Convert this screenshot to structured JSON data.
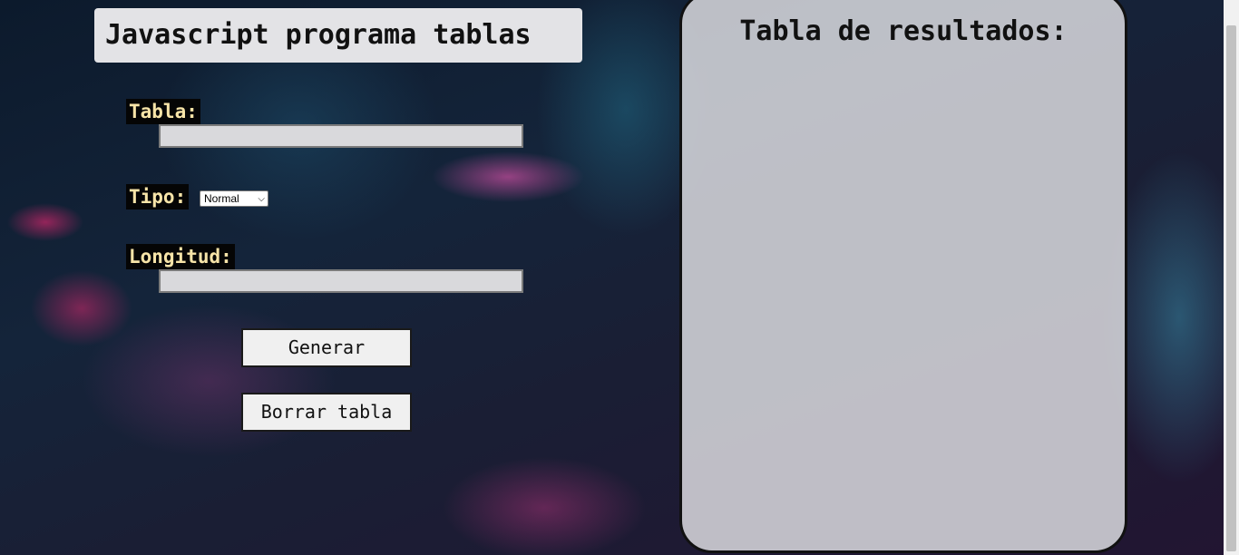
{
  "header": {
    "title": "Javascript programa tablas"
  },
  "form": {
    "tabla_label": "Tabla:",
    "tabla_value": "",
    "tipo_label": "Tipo:",
    "tipo_selected": "Normal",
    "longitud_label": "Longitud:",
    "longitud_value": "",
    "generar_label": "Generar",
    "borrar_label": "Borrar tabla"
  },
  "results": {
    "title": "Tabla de resultados:"
  }
}
